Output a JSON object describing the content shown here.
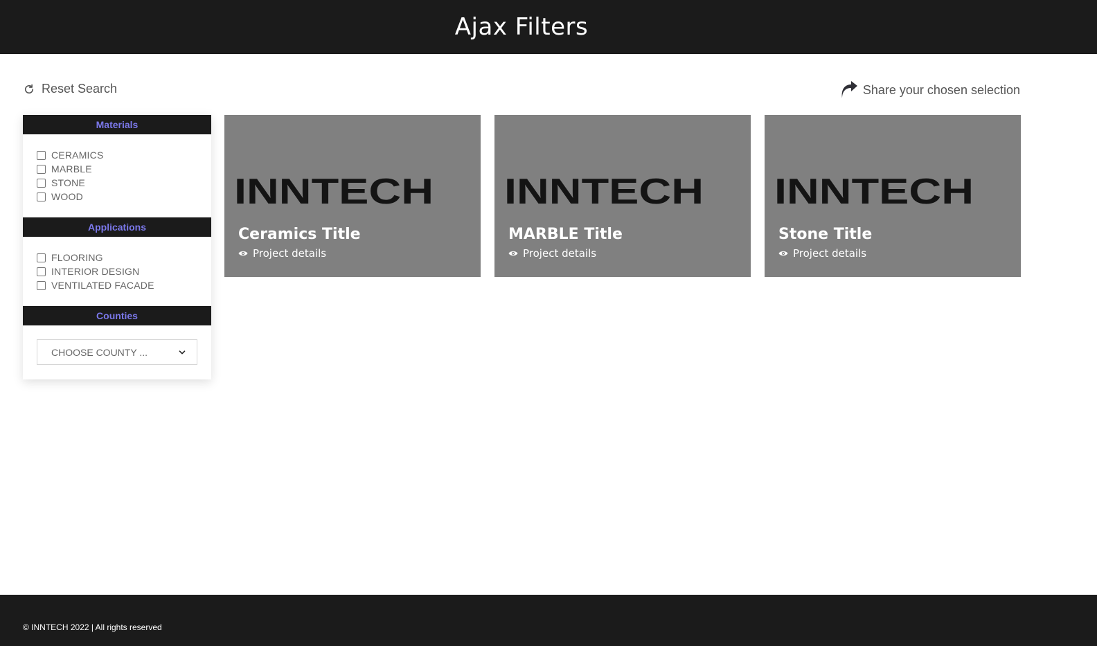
{
  "header": {
    "title": "Ajax Filters"
  },
  "toolbar": {
    "reset_label": "Reset Search",
    "share_label": "Share your chosen selection"
  },
  "filters": {
    "materials": {
      "heading": "Materials",
      "options": [
        {
          "label": "CERAMICS",
          "checked": false
        },
        {
          "label": "MARBLE",
          "checked": false
        },
        {
          "label": "STONE",
          "checked": false
        },
        {
          "label": "WOOD",
          "checked": false
        }
      ]
    },
    "applications": {
      "heading": "Applications",
      "options": [
        {
          "label": "FLOORING",
          "checked": false
        },
        {
          "label": "INTERIOR DESIGN",
          "checked": false
        },
        {
          "label": "VENTILATED FACADE",
          "checked": false
        }
      ]
    },
    "counties": {
      "heading": "Counties",
      "select_value": "CHOOSE COUNTY ..."
    }
  },
  "cards": [
    {
      "logo_text": "INNTECH",
      "title": "Ceramics Title",
      "details_label": "Project details"
    },
    {
      "logo_text": "INNTECH",
      "title": "MARBLE Title",
      "details_label": "Project details"
    },
    {
      "logo_text": "INNTECH",
      "title": "Stone Title",
      "details_label": "Project details"
    }
  ],
  "footer": {
    "copyright": "© INNTECH 2022 | All rights reserved"
  },
  "colors": {
    "header_bg": "#1b1b1b",
    "filter_heading_text": "#7b78ea",
    "card_bg": "#808080"
  }
}
